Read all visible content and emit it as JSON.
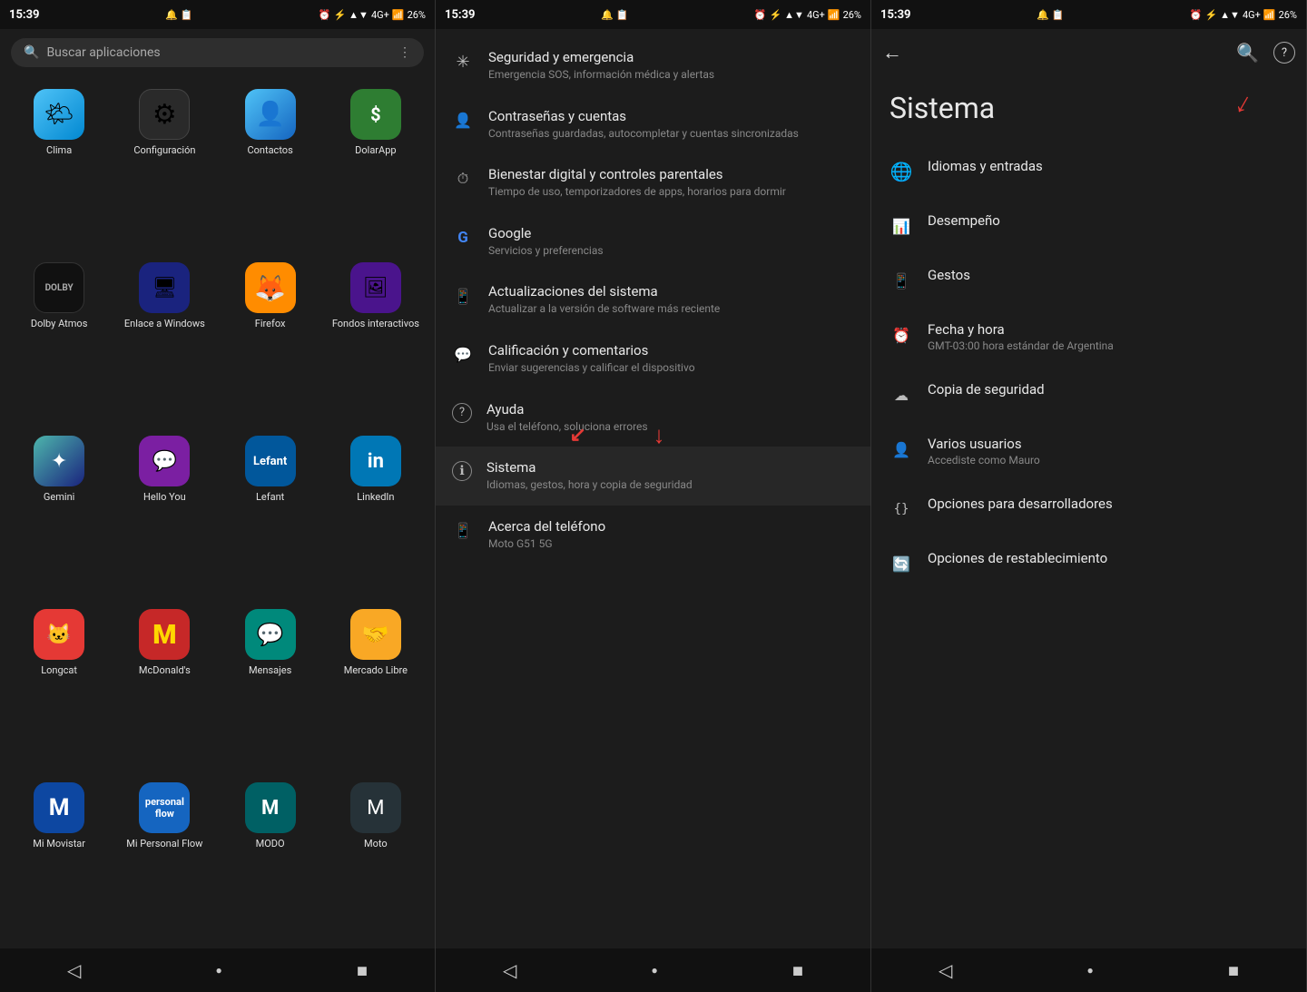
{
  "panels": {
    "panel1": {
      "statusBar": {
        "time": "15:39",
        "icons": "🔔 📋",
        "right": "⏰ ⚡ ▲ 4G+ ▲ 📶 26%"
      },
      "search": {
        "placeholder": "Buscar aplicaciones",
        "menuIcon": "⋮"
      },
      "apps": [
        {
          "id": "clima",
          "label": "Clima",
          "icon": "🌤",
          "color": "icon-clima"
        },
        {
          "id": "configuracion",
          "label": "Configuración",
          "icon": "⚙",
          "color": "icon-config"
        },
        {
          "id": "contactos",
          "label": "Contactos",
          "icon": "👤",
          "color": "icon-contactos"
        },
        {
          "id": "dolarapp",
          "label": "DolarApp",
          "icon": "$",
          "color": "icon-dolarapp"
        },
        {
          "id": "dolby",
          "label": "Dolby Atmos",
          "icon": "🎵",
          "color": "icon-dolby"
        },
        {
          "id": "enlace",
          "label": "Enlace a Windows",
          "icon": "🖥",
          "color": "icon-enlace"
        },
        {
          "id": "firefox",
          "label": "Firefox",
          "icon": "🦊",
          "color": "icon-firefox"
        },
        {
          "id": "fondos",
          "label": "Fondos interactivos",
          "icon": "🖼",
          "color": "icon-fondos"
        },
        {
          "id": "gemini",
          "label": "Gemini",
          "icon": "✦",
          "color": "icon-gemini"
        },
        {
          "id": "helloyou",
          "label": "Hello You",
          "icon": "💬",
          "color": "icon-helloyou"
        },
        {
          "id": "lefant",
          "label": "Lefant",
          "icon": "🤖",
          "color": "icon-lefant"
        },
        {
          "id": "linkedin",
          "label": "LinkedIn",
          "icon": "in",
          "color": "icon-linkedin"
        },
        {
          "id": "longcat",
          "label": "Longcat",
          "icon": "🐱",
          "color": "icon-longcat"
        },
        {
          "id": "mcdonalds",
          "label": "McDonald's",
          "icon": "M",
          "color": "icon-mcdonalds"
        },
        {
          "id": "mensajes",
          "label": "Mensajes",
          "icon": "💬",
          "color": "icon-mensajes"
        },
        {
          "id": "mercado",
          "label": "Mercado Libre",
          "icon": "🤝",
          "color": "icon-mercado"
        },
        {
          "id": "mimovistar",
          "label": "Mi Movistar",
          "icon": "M",
          "color": "icon-mimovistar"
        },
        {
          "id": "personal",
          "label": "Mi Personal Flow",
          "icon": "P",
          "color": "icon-personal"
        },
        {
          "id": "modo",
          "label": "MODO",
          "icon": "M",
          "color": "icon-modo"
        },
        {
          "id": "moto",
          "label": "Moto",
          "icon": "M",
          "color": "icon-moto"
        }
      ],
      "navBar": {
        "back": "◁",
        "home": "●",
        "recent": "■"
      }
    },
    "panel2": {
      "statusBar": {
        "time": "15:39"
      },
      "settings": [
        {
          "id": "seguridad",
          "icon": "✳",
          "title": "Seguridad y emergencia",
          "subtitle": "Emergencia SOS, información médica y alertas"
        },
        {
          "id": "contrasenas",
          "icon": "👤",
          "title": "Contraseñas y cuentas",
          "subtitle": "Contraseñas guardadas, autocompletar y cuentas sincronizadas"
        },
        {
          "id": "bienestar",
          "icon": "⏱",
          "title": "Bienestar digital y controles parentales",
          "subtitle": "Tiempo de uso, temporizadores de apps, horarios para dormir"
        },
        {
          "id": "google",
          "icon": "G",
          "title": "Google",
          "subtitle": "Servicios y preferencias"
        },
        {
          "id": "actualizaciones",
          "icon": "📱",
          "title": "Actualizaciones del sistema",
          "subtitle": "Actualizar a la versión de software más reciente"
        },
        {
          "id": "calificacion",
          "icon": "💬",
          "title": "Calificación y comentarios",
          "subtitle": "Enviar sugerencias y calificar el dispositivo"
        },
        {
          "id": "ayuda",
          "icon": "?",
          "title": "Ayuda",
          "subtitle": "Usa el teléfono, soluciona errores"
        },
        {
          "id": "sistema",
          "icon": "ℹ",
          "title": "Sistema",
          "subtitle": "Idiomas, gestos, hora y copia de seguridad"
        },
        {
          "id": "acerca",
          "icon": "📱",
          "title": "Acerca del teléfono",
          "subtitle": "Moto G51 5G"
        }
      ]
    },
    "panel3": {
      "statusBar": {
        "time": "15:39"
      },
      "title": "Sistema",
      "items": [
        {
          "id": "idiomas",
          "icon": "🌐",
          "title": "Idiomas y entradas",
          "subtitle": ""
        },
        {
          "id": "desempeno",
          "icon": "📊",
          "title": "Desempeño",
          "subtitle": ""
        },
        {
          "id": "gestos",
          "icon": "📱",
          "title": "Gestos",
          "subtitle": ""
        },
        {
          "id": "fecha",
          "icon": "⏰",
          "title": "Fecha y hora",
          "subtitle": "GMT-03:00 hora estándar de Argentina"
        },
        {
          "id": "copia",
          "icon": "☁",
          "title": "Copia de seguridad",
          "subtitle": ""
        },
        {
          "id": "usuarios",
          "icon": "👤",
          "title": "Varios usuarios",
          "subtitle": "Accediste como Mauro"
        },
        {
          "id": "opciones-dev",
          "icon": "{}",
          "title": "Opciones para desarrolladores",
          "subtitle": ""
        },
        {
          "id": "opciones-reset",
          "icon": "🔄",
          "title": "Opciones de restablecimiento",
          "subtitle": ""
        }
      ]
    }
  }
}
